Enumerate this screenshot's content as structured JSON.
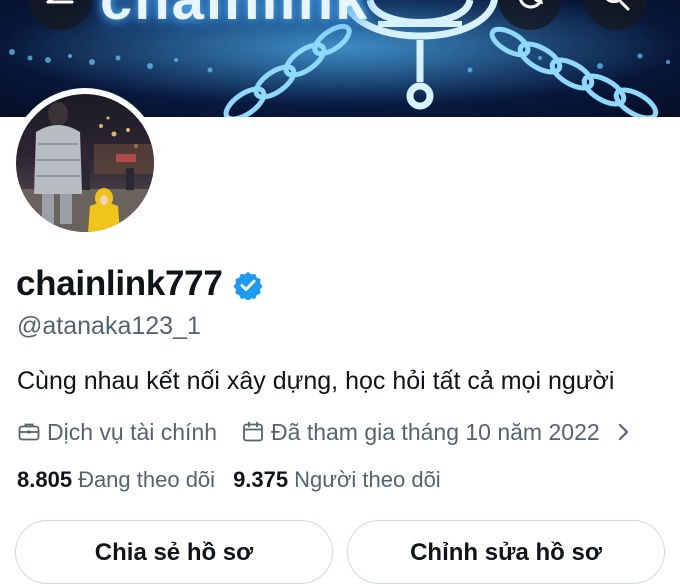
{
  "banner": {
    "title": "chainlink"
  },
  "header_buttons": {
    "back": "back-arrow-icon",
    "refresh": "refresh-icon",
    "search": "search-icon"
  },
  "profile": {
    "display_name": "chainlink777",
    "verified": true,
    "handle": "@atanaka123_1",
    "bio": "Cùng nhau kết nối xây dựng, học hỏi tất cả mọi người",
    "category": "Dịch vụ tài chính",
    "joined": "Đã tham gia tháng 10 năm 2022"
  },
  "stats": {
    "following_count": "8.805",
    "following_label": "Đang theo dõi",
    "followers_count": "9.375",
    "followers_label": "Người theo dõi"
  },
  "actions": {
    "share_label": "Chia sẻ hồ sơ",
    "edit_label": "Chỉnh sửa hồ sơ"
  },
  "colors": {
    "verified_blue": "#1d9bf0",
    "text_primary": "#0f1419",
    "text_secondary": "#536471",
    "border": "#cfd9de"
  }
}
